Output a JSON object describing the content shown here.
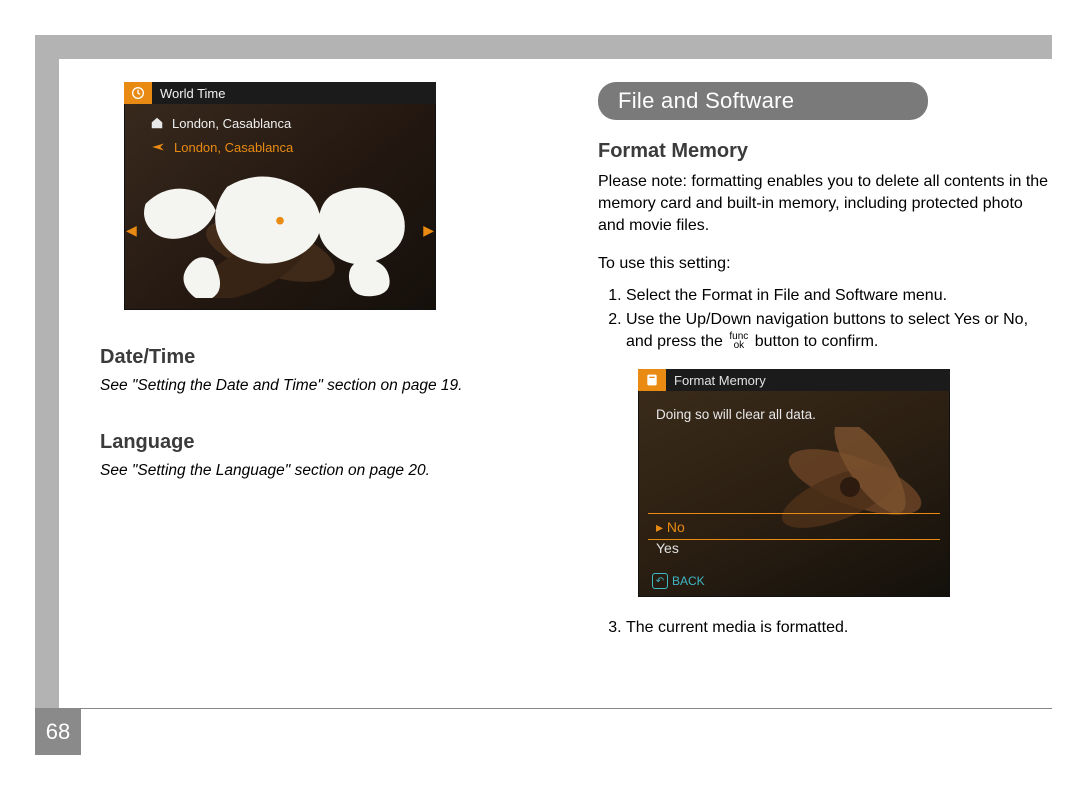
{
  "page_number": "68",
  "left": {
    "screenshot_worldtime": {
      "header": "World Time",
      "home_row": "London, Casablanca",
      "away_row": "London, Casablanca"
    },
    "datetime_heading": "Date/Time",
    "datetime_ref": "See \"Setting the Date and Time\" section on page 19.",
    "language_heading": "Language",
    "language_ref": "See \"Setting the Language\" section on page 20."
  },
  "right": {
    "section_title": "File and Software",
    "format_heading": "Format Memory",
    "note": "Please note:  formatting enables you to delete all contents in the memory card and built-in memory, including protected photo and movie files.",
    "steps_intro": "To use this setting:",
    "step1": "Select the Format in File and Software menu.",
    "step2_a": "Use the Up/Down navigation buttons to select Yes or No, and press the ",
    "step2_b": " button to confirm.",
    "func_label_top": "func",
    "func_label_bot": "ok",
    "step3": "The current media is formatted.",
    "screenshot_format": {
      "header": "Format Memory",
      "message": "Doing so will clear all data.",
      "option_no": "No",
      "option_yes": "Yes",
      "back_label": "BACK"
    }
  }
}
